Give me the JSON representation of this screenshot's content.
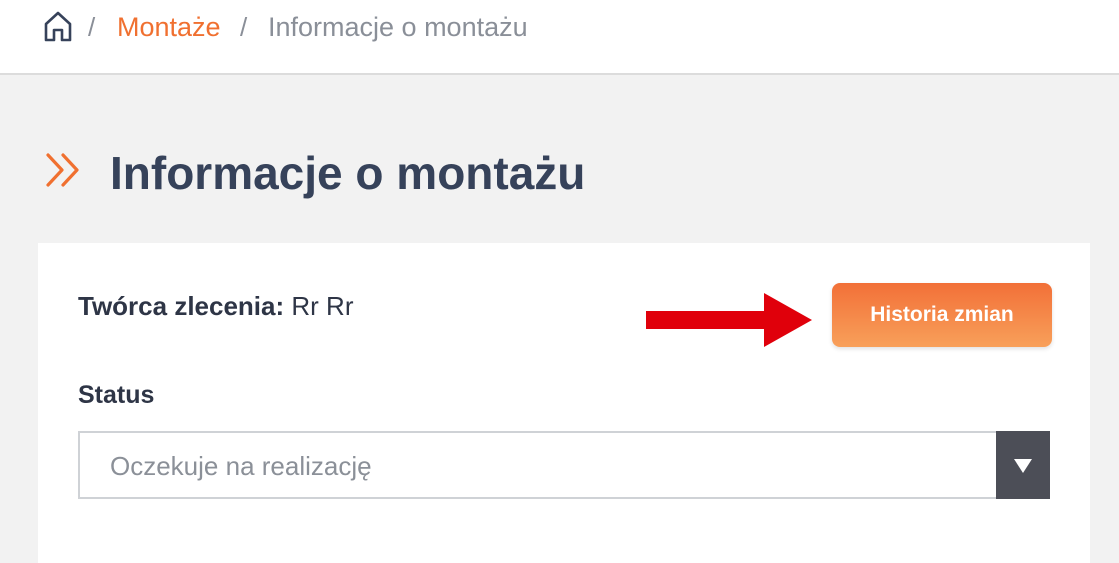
{
  "breadcrumb": {
    "home_icon": "home-icon",
    "separator": "/",
    "link_label": "Montaże",
    "current_label": "Informacje o montażu"
  },
  "page": {
    "title": "Informacje o montażu",
    "title_icon": "double-chevron-right-icon"
  },
  "card": {
    "creator_label": "Twórca zlecenia:",
    "creator_value": "Rr Rr",
    "history_button_label": "Historia zmian",
    "annotation_icon": "red-arrow-right-icon",
    "status_label": "Status",
    "status_selected": "Oczekuje na realizację"
  },
  "colors": {
    "accent": "#f07030",
    "title": "#36425a",
    "annotation_arrow": "#e0000b",
    "select_toggle": "#4c4e57"
  }
}
